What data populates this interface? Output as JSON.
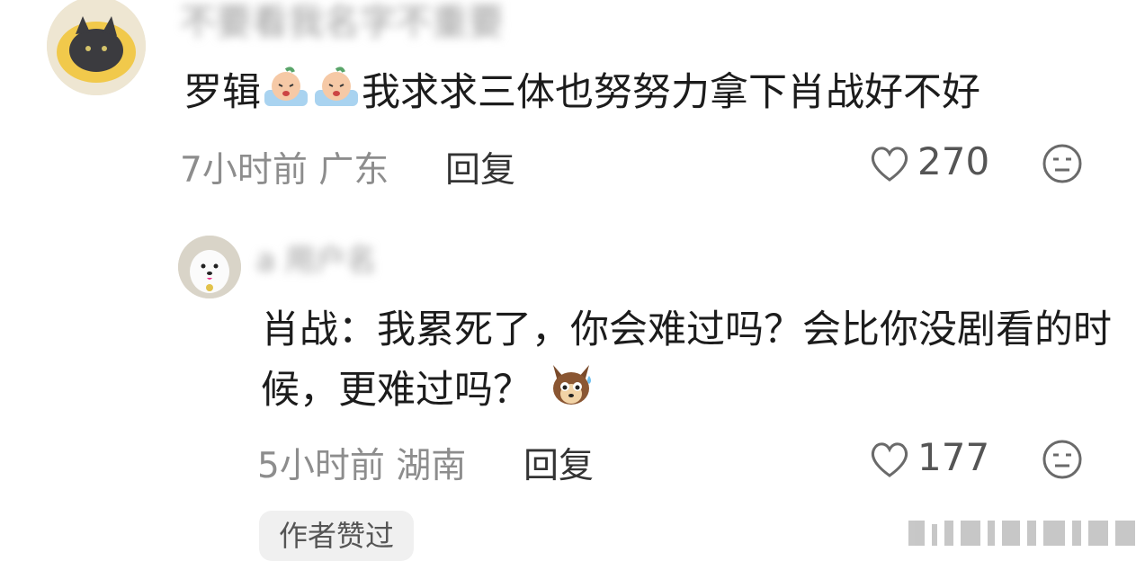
{
  "comments": [
    {
      "username": "不要看我名字不重要",
      "text_before_emoji": "罗辑",
      "text_after_emoji": "我求求三体也努努力拿下肖战好不好",
      "time": "7小时前",
      "location": "广东",
      "reply_label": "回复",
      "likes": "270"
    },
    {
      "username": "a 用户名",
      "text": "肖战：我累死了，你会难过吗？会比你没剧看的时候，更难过吗？",
      "time": "5小时前",
      "location": "湖南",
      "reply_label": "回复",
      "likes": "177",
      "author_badge": "作者赞过"
    }
  ],
  "icons": {
    "like": "heart-outline-icon",
    "dislike": "neutral-face-icon",
    "emoji_1": "crying-emoji",
    "emoji_2": "dog-sweat-emoji"
  },
  "colors": {
    "text": "#1c1c1c",
    "meta": "#8d8d8d",
    "badge_bg": "#f0f0f0"
  }
}
